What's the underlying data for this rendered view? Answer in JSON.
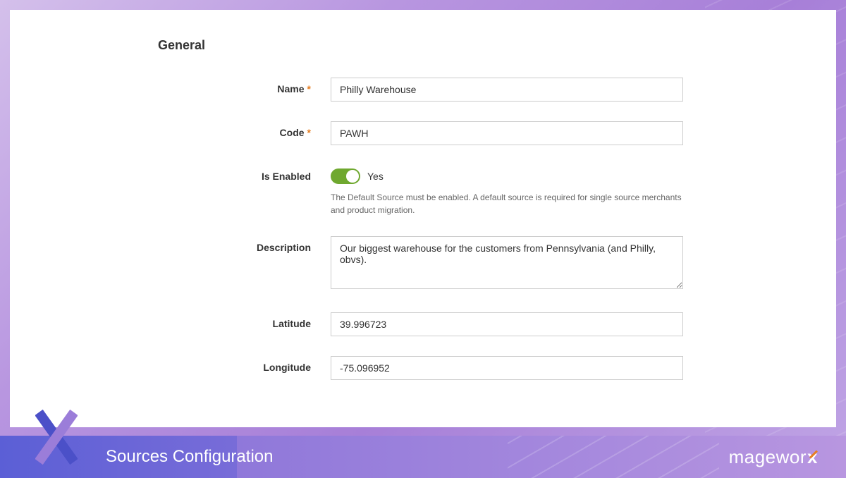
{
  "section": {
    "title": "General"
  },
  "form": {
    "name": {
      "label": "Name",
      "value": "Philly Warehouse",
      "required": true
    },
    "code": {
      "label": "Code",
      "value": "PAWH",
      "required": true
    },
    "is_enabled": {
      "label": "Is Enabled",
      "state_text": "Yes",
      "enabled": true,
      "helper": "The Default Source must be enabled. A default source is required for single source merchants and product migration."
    },
    "description": {
      "label": "Description",
      "value": "Our biggest warehouse for the customers from Pennsylvania (and Philly, obvs)."
    },
    "latitude": {
      "label": "Latitude",
      "value": "39.996723"
    },
    "longitude": {
      "label": "Longitude",
      "value": "-75.096952"
    }
  },
  "footer": {
    "title": "Sources Configuration",
    "brand_prefix": "magewor",
    "brand_suffix": "x"
  }
}
